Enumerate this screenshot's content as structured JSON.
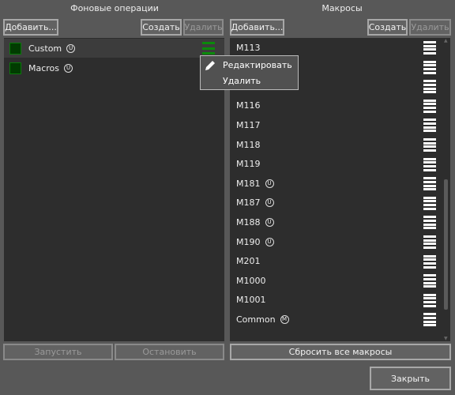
{
  "left": {
    "title": "Фоновые операции",
    "add": "Добавить...",
    "create": "Создать",
    "delete": "Удалить",
    "items": [
      {
        "name": "Custom",
        "badge": "U",
        "selected": true
      },
      {
        "name": "Macros",
        "badge": "U",
        "selected": false
      }
    ],
    "start": "Запустить",
    "stop": "Остановить"
  },
  "right": {
    "title": "Макросы",
    "add": "Добавить...",
    "create": "Создать",
    "delete": "Удалить",
    "items": [
      {
        "name": "M113",
        "badge": ""
      },
      {
        "name": "",
        "badge": ""
      },
      {
        "name": "",
        "badge": ""
      },
      {
        "name": "M116",
        "badge": ""
      },
      {
        "name": "M117",
        "badge": ""
      },
      {
        "name": "M118",
        "badge": ""
      },
      {
        "name": "M119",
        "badge": ""
      },
      {
        "name": "M181",
        "badge": "U"
      },
      {
        "name": "M187",
        "badge": "U"
      },
      {
        "name": "M188",
        "badge": "U"
      },
      {
        "name": "M190",
        "badge": "U"
      },
      {
        "name": "M201",
        "badge": ""
      },
      {
        "name": "M1000",
        "badge": ""
      },
      {
        "name": "M1001",
        "badge": ""
      },
      {
        "name": "Common",
        "badge": "M"
      }
    ],
    "reset": "Сбросить все макросы",
    "scroll_position": 0.85
  },
  "context_menu": {
    "edit": "Редактировать",
    "delete": "Удалить"
  },
  "close": "Закрыть"
}
